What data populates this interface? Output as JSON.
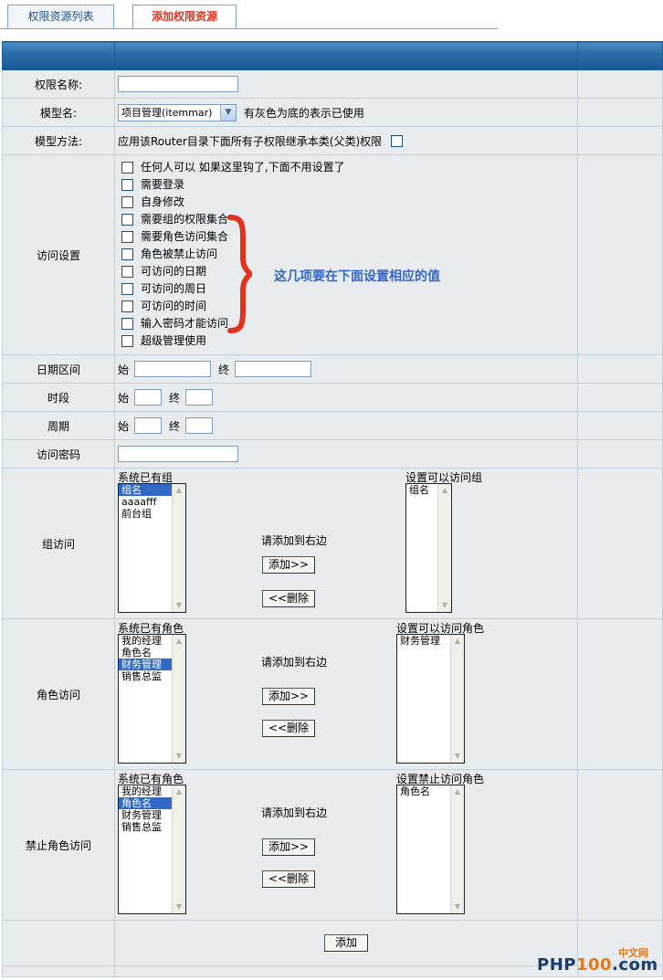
{
  "tabs": [
    {
      "label": "权限资源列表"
    },
    {
      "label": "添加权限资源"
    }
  ],
  "form": {
    "name_label": "权限名称:",
    "name_value": "",
    "model_label": "模型名:",
    "model_selected": "项目管理(itemmar)",
    "model_note": "有灰色为底的表示已使用",
    "method_label": "模型方法:",
    "method_text": "应用该Router目录下面所有子权限继承本类(父类)权限",
    "access_label": "访问设置",
    "access_options": [
      "任何人可以  如果这里钩了,下面不用设置了",
      "需要登录",
      "自身修改",
      "需要组的权限集合",
      "需要角色访问集合",
      "角色被禁止访问",
      "可访问的日期",
      "可访问的周日",
      "可访问的时间",
      "输入密码才能访问",
      "超级管理使用"
    ],
    "date_label": "日期区间",
    "time_label": "时段",
    "cycle_label": "周期",
    "start_label": "始",
    "end_label": "终",
    "password_label": "访问密码",
    "group_label": "组访问",
    "group_left_title": "系统已有组",
    "group_left_items": [
      "组名",
      "aaaafff",
      "前台组"
    ],
    "group_right_title": "设置可以访问组",
    "group_right_items": [
      "组名"
    ],
    "role_label": "角色访问",
    "role_left_title": "系统已有角色",
    "role_left_items": [
      "我的经理",
      "角色名",
      "财务管理",
      "销售总监"
    ],
    "role_right_title": "设置可以访问角色",
    "role_right_items": [
      "财务管理"
    ],
    "deny_label": "禁止角色访问",
    "deny_left_title": "系统已有角色",
    "deny_left_items": [
      "我的经理",
      "角色名",
      "财务管理",
      "销售总监"
    ],
    "deny_right_title": "设置禁止访问角色",
    "deny_right_items": [
      "角色名"
    ],
    "hint_text": "请添加到右边",
    "add_btn": "添加>>",
    "del_btn": "<<删除",
    "submit_btn": "添加"
  },
  "annotation": "这几项要在下面设置相应的值",
  "watermark": {
    "cn": "中文网",
    "php": "PHP",
    "num": "100",
    "tail": ".com"
  },
  "colors": {
    "accent_red": "#e0321e",
    "header_blue": "#2a6ea9",
    "annotation_blue": "#3366cc"
  }
}
